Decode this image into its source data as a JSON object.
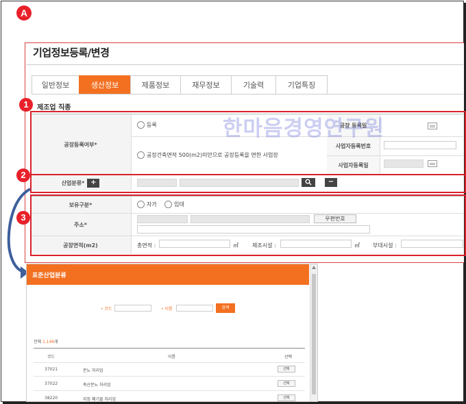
{
  "figure_label": "A",
  "page_title": "기업정보등록/변경",
  "tabs": [
    "일반정보",
    "생산정보",
    "제품정보",
    "재무정보",
    "기술력",
    "기업특징"
  ],
  "active_tab": "생산정보",
  "section_title": "제조업 직종",
  "markers": [
    "1",
    "2",
    "3"
  ],
  "watermark": "한마음경영연구원",
  "factory": {
    "label": "공장등록여부*",
    "option_registered": "등록",
    "option_small": "공장건축면적 500(m2)미만으로 공장등록을 면한 사업장",
    "reg_date_label": "공장 등록일",
    "biz_no_label": "사업자등록번호",
    "biz_reg_date_label": "사업자등록일"
  },
  "industry": {
    "label": "산업분류*",
    "add_label": "+",
    "search_icon": "search-icon",
    "remove_label": "−"
  },
  "ownership": {
    "label": "보유구분*",
    "option_own": "자가",
    "option_lease": "임대"
  },
  "address": {
    "label": "주소*",
    "postcode_button": "우편번호"
  },
  "area": {
    "label": "공장면적(m2)",
    "total_label": "총면적 :",
    "total_unit": "㎡",
    "mfg_label": "제조시설 :",
    "mfg_unit": "㎡",
    "aux_label": "부대시설 :"
  },
  "popup": {
    "title": "표준산업분류",
    "code_label": "• 코드",
    "name_label": "• 이름",
    "search_button": "검색",
    "total_prefix": "전체 ",
    "total_count": "1,146",
    "total_suffix": "개",
    "columns": [
      "코드",
      "이름",
      "선택"
    ],
    "rows": [
      {
        "code": "37021",
        "name": "분뇨 처리업",
        "select": "선택"
      },
      {
        "code": "37022",
        "name": "축산분뇨 처리업",
        "select": "선택"
      },
      {
        "code": "38220",
        "name": "지정 폐기물 처리업",
        "select": "선택"
      }
    ]
  },
  "colors": {
    "accent": "#f37021",
    "marker_red": "#e8202a",
    "arrow_blue": "#3e5f9c"
  }
}
